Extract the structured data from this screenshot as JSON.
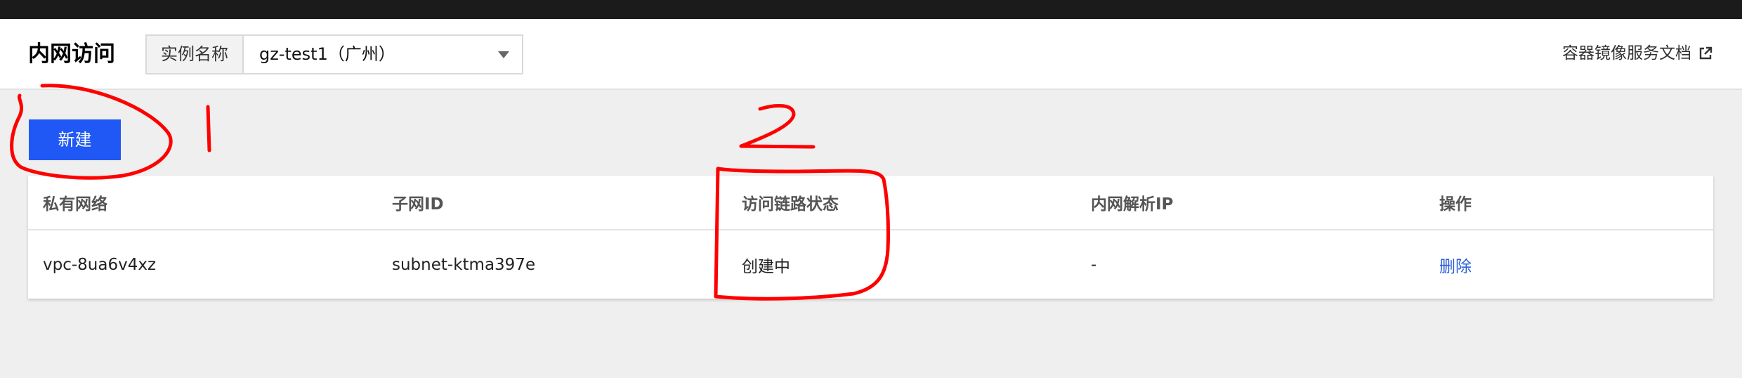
{
  "header": {
    "title": "内网访问",
    "instance_label": "实例名称",
    "instance_selected": "gz-test1（广州）",
    "doc_link": "容器镜像服务文档",
    "doc_icon": "external-link-icon"
  },
  "toolbar": {
    "new_label": "新建"
  },
  "table": {
    "columns": [
      "私有网络",
      "子网ID",
      "访问链路状态",
      "内网解析IP",
      "操作"
    ],
    "rows": [
      {
        "vpc": "vpc-8ua6v4xz",
        "subnet": "subnet-ktma397e",
        "status": "创建中",
        "ip": "-",
        "action": "删除"
      }
    ]
  },
  "annotations": {
    "mark_1": "1",
    "mark_2": "2",
    "color": "#ff0000"
  },
  "colors": {
    "accent": "#1f58f5",
    "link": "#2a5fd8"
  }
}
